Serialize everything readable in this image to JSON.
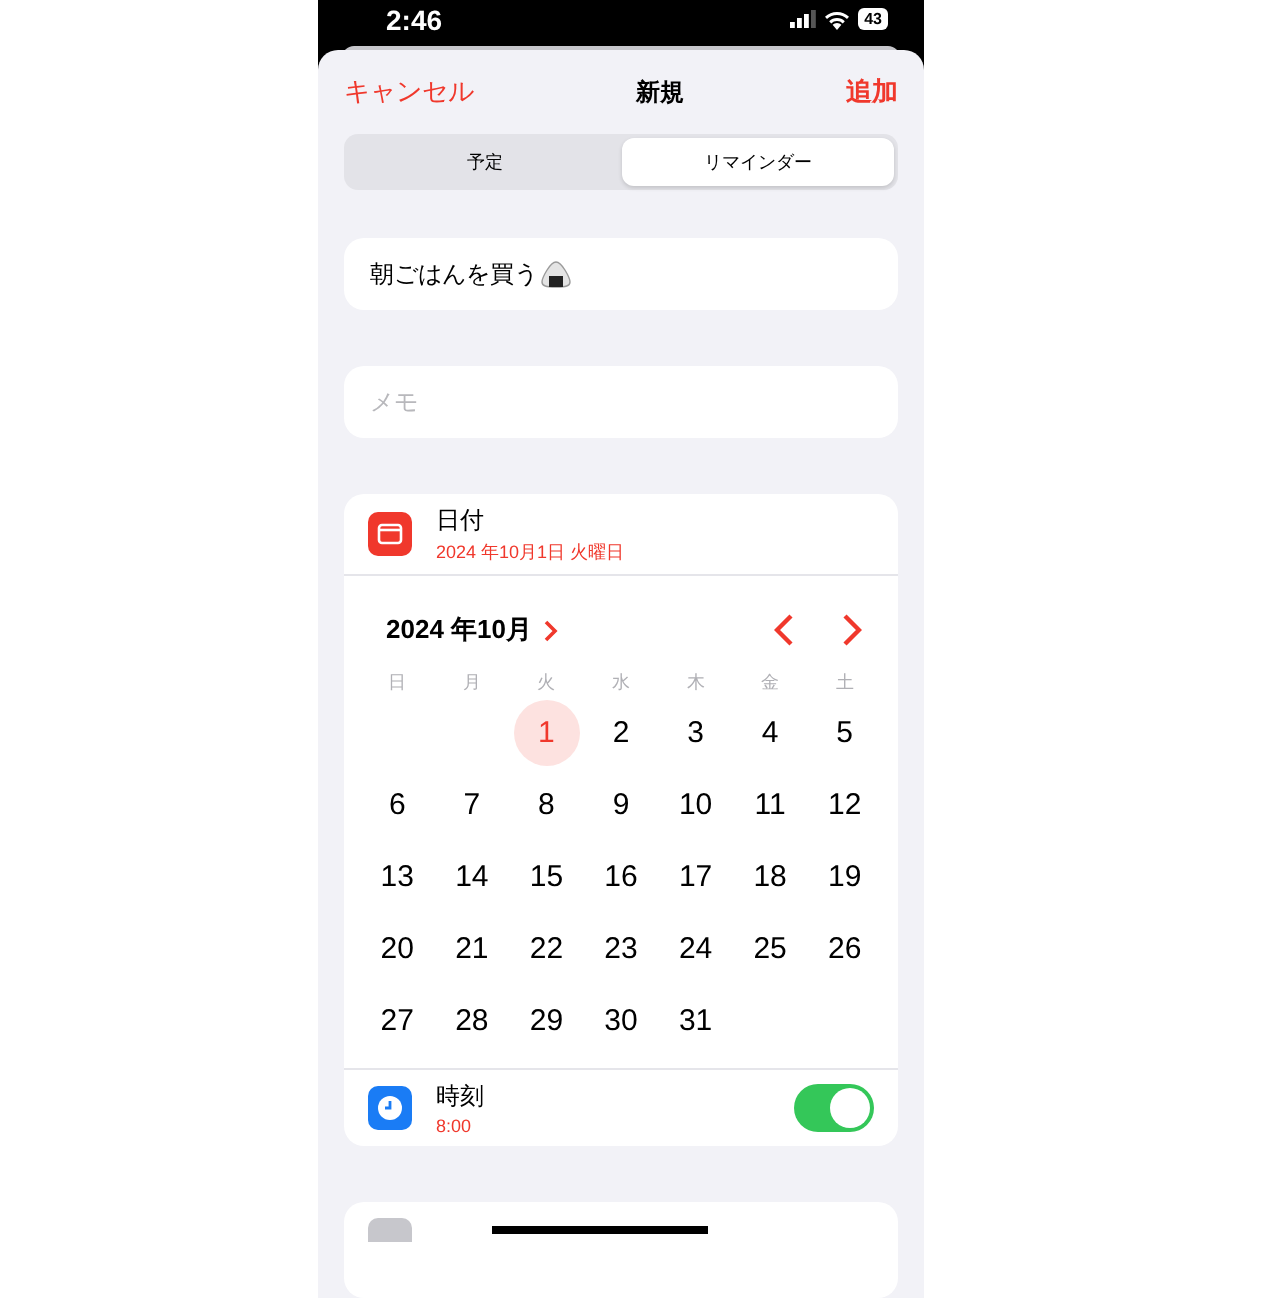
{
  "status_bar": {
    "time": "2:46",
    "battery": "43"
  },
  "nav": {
    "cancel": "キャンセル",
    "title": "新規",
    "add": "追加"
  },
  "segments": [
    {
      "label": "予定",
      "selected": false
    },
    {
      "label": "リマインダー",
      "selected": true
    }
  ],
  "title_field": {
    "value": "朝ごはんを買う"
  },
  "memo_field": {
    "placeholder": "メモ"
  },
  "date_row": {
    "label": "日付",
    "value": "2024 年10月1日 火曜日"
  },
  "calendar": {
    "month": "2024 年10月",
    "weekdays": [
      "日",
      "月",
      "火",
      "水",
      "木",
      "金",
      "土"
    ],
    "weeks": [
      [
        {
          "kind": "blank"
        },
        {
          "kind": "blank"
        },
        {
          "kind": "day",
          "label": "1",
          "selected": true
        },
        {
          "kind": "day",
          "label": "2",
          "selected": false
        },
        {
          "kind": "day",
          "label": "3",
          "selected": false
        },
        {
          "kind": "day",
          "label": "4",
          "selected": false
        },
        {
          "kind": "day",
          "label": "5",
          "selected": false
        }
      ],
      [
        {
          "kind": "day",
          "label": "6",
          "selected": false
        },
        {
          "kind": "day",
          "label": "7",
          "selected": false
        },
        {
          "kind": "day",
          "label": "8",
          "selected": false
        },
        {
          "kind": "day",
          "label": "9",
          "selected": false
        },
        {
          "kind": "day",
          "label": "10",
          "selected": false
        },
        {
          "kind": "day",
          "label": "11",
          "selected": false
        },
        {
          "kind": "day",
          "label": "12",
          "selected": false
        }
      ],
      [
        {
          "kind": "day",
          "label": "13",
          "selected": false
        },
        {
          "kind": "day",
          "label": "14",
          "selected": false
        },
        {
          "kind": "day",
          "label": "15",
          "selected": false
        },
        {
          "kind": "day",
          "label": "16",
          "selected": false
        },
        {
          "kind": "day",
          "label": "17",
          "selected": false
        },
        {
          "kind": "day",
          "label": "18",
          "selected": false
        },
        {
          "kind": "day",
          "label": "19",
          "selected": false
        }
      ],
      [
        {
          "kind": "day",
          "label": "20",
          "selected": false
        },
        {
          "kind": "day",
          "label": "21",
          "selected": false
        },
        {
          "kind": "day",
          "label": "22",
          "selected": false
        },
        {
          "kind": "day",
          "label": "23",
          "selected": false
        },
        {
          "kind": "day",
          "label": "24",
          "selected": false
        },
        {
          "kind": "day",
          "label": "25",
          "selected": false
        },
        {
          "kind": "day",
          "label": "26",
          "selected": false
        }
      ],
      [
        {
          "kind": "day",
          "label": "27",
          "selected": false
        },
        {
          "kind": "day",
          "label": "28",
          "selected": false
        },
        {
          "kind": "day",
          "label": "29",
          "selected": false
        },
        {
          "kind": "day",
          "label": "30",
          "selected": false
        },
        {
          "kind": "day",
          "label": "31",
          "selected": false
        },
        {
          "kind": "blank"
        },
        {
          "kind": "blank"
        }
      ]
    ]
  },
  "time_row": {
    "label": "時刻",
    "value": "8:00",
    "on": true
  }
}
